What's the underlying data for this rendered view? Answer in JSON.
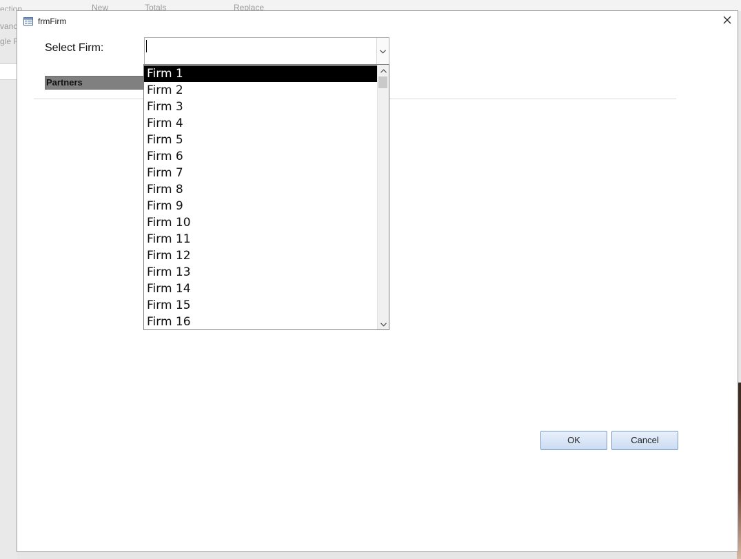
{
  "window": {
    "title": "frmFirm",
    "close_icon": "close-icon",
    "app_icon": "form-icon"
  },
  "form": {
    "select_label": "Select Firm:",
    "combo_value": "",
    "partners_label": "Partners"
  },
  "dropdown": {
    "items": [
      "Firm 1",
      "Firm 2",
      "Firm 3",
      "Firm 4",
      "Firm 5",
      "Firm 6",
      "Firm 7",
      "Firm 8",
      "Firm 9",
      "Firm 10",
      "Firm 11",
      "Firm 12",
      "Firm 13",
      "Firm 14",
      "Firm 15",
      "Firm 16"
    ],
    "selected_index": 0
  },
  "buttons": {
    "ok": "OK",
    "cancel": "Cancel"
  },
  "background": {
    "ribbon_items": [
      "ection",
      "New",
      "Totals",
      "Replace"
    ],
    "side_items": [
      "vanc",
      "gle F"
    ]
  },
  "colors": {
    "selected_bg": "#000000",
    "button_bg": "#cbdcf2",
    "partners_bg": "#808080"
  }
}
